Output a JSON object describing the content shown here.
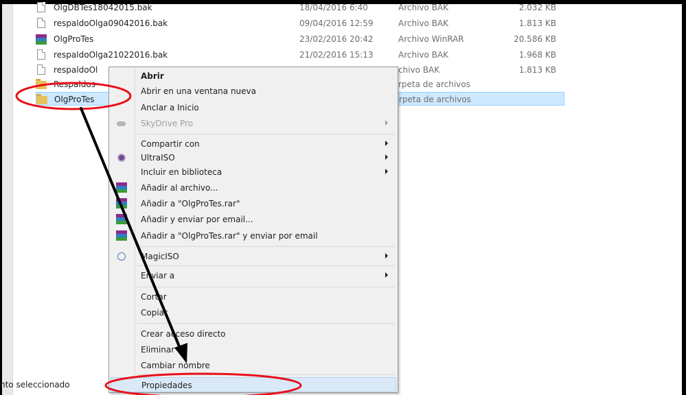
{
  "files": [
    {
      "name": "OlgDBTes18042015.bak",
      "date": "18/04/2016 6:40",
      "type": "Archivo BAK",
      "size": "2.032 KB",
      "icon": "document-icon"
    },
    {
      "name": "respaldoOlga09042016.bak",
      "date": "09/04/2016 12:59",
      "type": "Archivo BAK",
      "size": "1.813 KB",
      "icon": "document-icon"
    },
    {
      "name": "OlgProTes",
      "date": "23/02/2016 20:42",
      "type": "Archivo WinRAR",
      "size": "20.586 KB",
      "icon": "winrar-icon"
    },
    {
      "name": "respaldoOlga21022016.bak",
      "date": "21/02/2016 15:13",
      "type": "Archivo BAK",
      "size": "1.968 KB",
      "icon": "document-icon"
    },
    {
      "name": "respaldoOl",
      "date": "",
      "type": "chivo BAK",
      "size": "1.813 KB",
      "icon": "document-icon"
    },
    {
      "name": "Respaldos",
      "date": "",
      "type": "rpeta de archivos",
      "size": "",
      "icon": "folder-icon"
    },
    {
      "name": "OlgProTes",
      "date": "",
      "type": "rpeta de archivos",
      "size": "",
      "icon": "folder-icon"
    }
  ],
  "context_menu": {
    "items": [
      {
        "label": "Abrir"
      },
      {
        "label": "Abrir en una ventana nueva"
      },
      {
        "label": "Anclar a Inicio"
      },
      {
        "label": "SkyDrive Pro"
      },
      {
        "label": "Compartir con"
      },
      {
        "label": "UltraISO"
      },
      {
        "label": "Incluir en biblioteca"
      },
      {
        "label": "Añadir al archivo..."
      },
      {
        "label": "Añadir a \"OlgProTes.rar\""
      },
      {
        "label": "Añadir y enviar por email..."
      },
      {
        "label": "Añadir a \"OlgProTes.rar\" y enviar por email"
      },
      {
        "label": "MagicISO"
      },
      {
        "label": "Enviar a"
      },
      {
        "label": "Cortar"
      },
      {
        "label": "Copiar"
      },
      {
        "label": "Crear acceso directo"
      },
      {
        "label": "Eliminar"
      },
      {
        "label": "Cambiar nombre"
      },
      {
        "label": "Propiedades"
      }
    ]
  },
  "status_bar": {
    "text": "nto seleccionado"
  },
  "colors": {
    "selection": "#cde8ff",
    "menu_background": "#f0f0f0",
    "annotation_red": "#e8101a",
    "annotation_arrow": "#000000"
  }
}
